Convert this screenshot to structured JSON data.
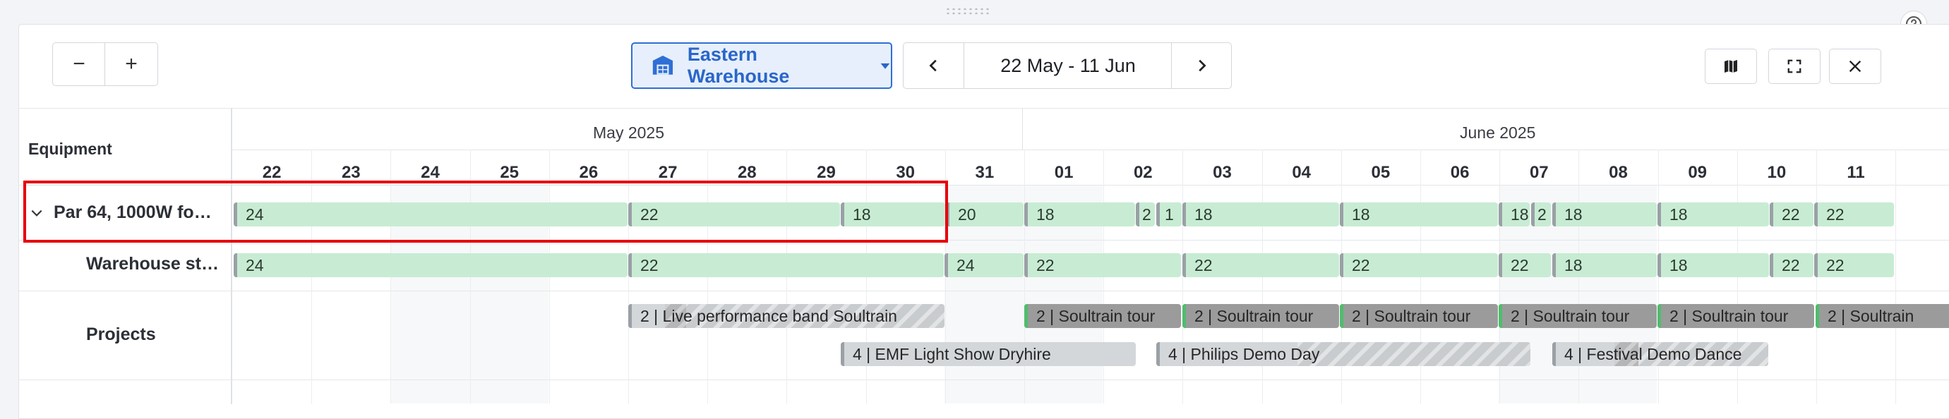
{
  "toolbar": {
    "zoom_out": "−",
    "zoom_in": "+",
    "warehouse": "Eastern Warehouse",
    "date_range": "22 May - 11 Jun"
  },
  "grid": {
    "equipment_header": "Equipment",
    "months": [
      "May 2025",
      "June 2025"
    ],
    "days": [
      "22",
      "23",
      "24",
      "25",
      "26",
      "27",
      "28",
      "29",
      "30",
      "31",
      "01",
      "02",
      "03",
      "04",
      "05",
      "06",
      "07",
      "08",
      "09",
      "10",
      "11"
    ]
  },
  "rows": {
    "item_label": "Par 64, 1000W fo…",
    "stock_label": "Warehouse st…",
    "projects_label": "Projects"
  },
  "availability_bars": [
    "24",
    "22",
    "18",
    "20",
    "18",
    "2",
    "1",
    "18",
    "18",
    "18",
    "2",
    "18",
    "18",
    "22",
    "22"
  ],
  "stock_bars": [
    "24",
    "22",
    "24",
    "22",
    "22",
    "22",
    "22",
    "18",
    "18",
    "22",
    "22"
  ],
  "projects": [
    "2 | Live performance band Soultrain",
    "2 | Soultrain tour",
    "2 | Soultrain tour",
    "2 | Soultrain tour",
    "2 | Soultrain tour",
    "2 | Soultrain tour",
    "2 | Soultrain",
    "4 | EMF Light Show Dryhire",
    "4 | Philips Demo Day",
    "4 | Festival Demo Dance"
  ],
  "colors": {
    "accent": "#2f6fd6",
    "available": "#c7ecd3",
    "project_bar": "#9b9b9b",
    "highlight": "#e8000b"
  },
  "icons": {
    "warehouse": "warehouse-icon",
    "dropdown": "caret-down-icon",
    "prev": "chevron-left-icon",
    "next": "chevron-right-icon",
    "map": "map-icon",
    "fullscreen": "fullscreen-icon",
    "close": "close-icon",
    "help": "help-icon",
    "expand": "chevron-down-icon"
  }
}
